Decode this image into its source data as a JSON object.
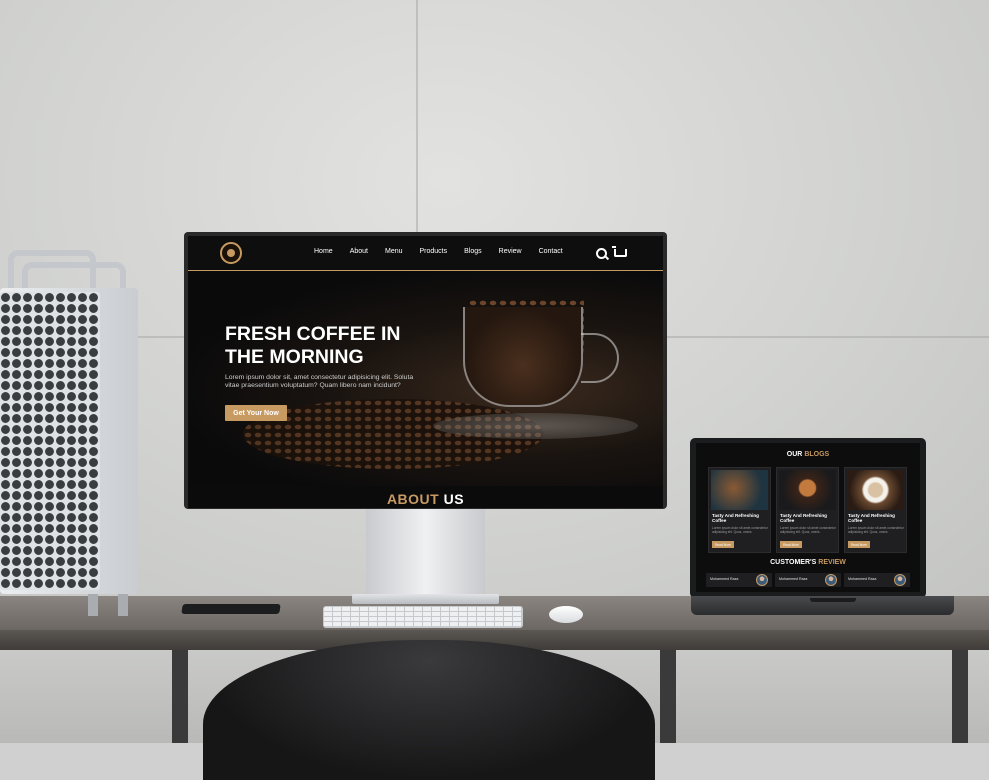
{
  "monitor_site": {
    "nav": {
      "logo": "coffee-logo",
      "menu": [
        "Home",
        "About",
        "Menu",
        "Products",
        "Blogs",
        "Review",
        "Contact"
      ],
      "icons": [
        "search-icon",
        "cart-icon"
      ]
    },
    "hero": {
      "title_line1": "FRESH COFFEE IN",
      "title_line2": "THE MORNING",
      "description": "Lorem ipsum dolor sit, amet consectetur adipisicing elit. Soluta vitae praesentium voluptatum? Quam libero nam incidunt?",
      "cta_label": "Get Your Now"
    },
    "about_heading": {
      "accent": "ABOUT",
      "rest": "US"
    }
  },
  "laptop_site": {
    "blogs_heading": {
      "accent_white": "OUR",
      "accent_gold": "BLOGS"
    },
    "blog_cards": [
      {
        "title": "Tasty And Refreshing Coffee",
        "text": "Lorem ipsum dolor sit amet consectetur adipisicing elit. Quos, omnis.",
        "button": "Read More"
      },
      {
        "title": "Tasty And Refreshing Coffee",
        "text": "Lorem ipsum dolor sit amet consectetur adipisicing elit. Quos, omnis.",
        "button": "Read More"
      },
      {
        "title": "Tasty And Refreshing Coffee",
        "text": "Lorem ipsum dolor sit amet consectetur adipisicing elit. Quos, omnis.",
        "button": "Read More"
      }
    ],
    "review_heading": {
      "white": "CUSTOMER'S",
      "gold": "REVIEW"
    },
    "reviews": [
      "Mohammed Raza",
      "Mohammed Raza",
      "Mohammed Raza"
    ]
  },
  "colors": {
    "accent": "#c79a62",
    "site_bg": "#0b0b0c",
    "wall": "#d2d3d1"
  }
}
